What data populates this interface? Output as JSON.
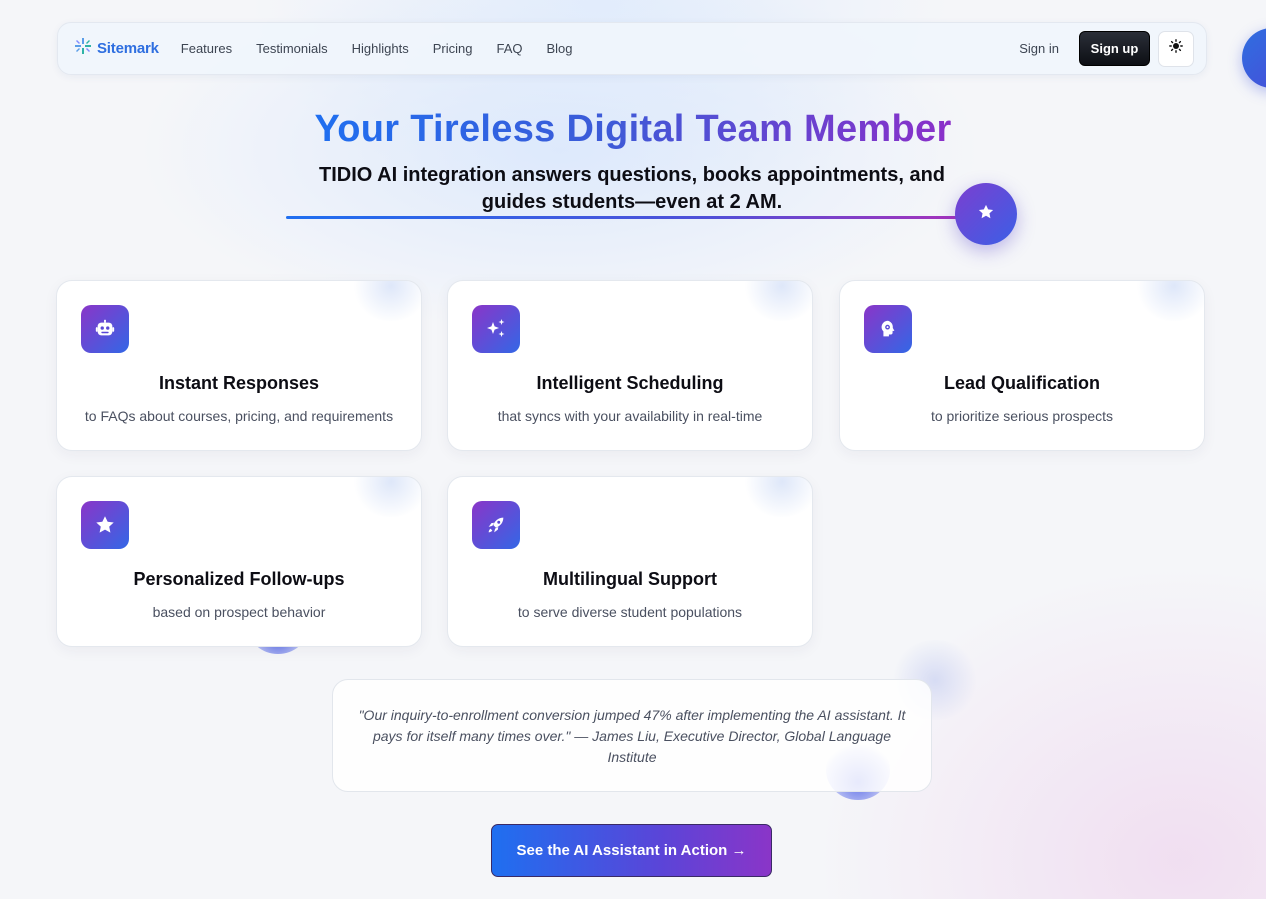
{
  "nav": {
    "logo_text": "Sitemark",
    "links": [
      "Features",
      "Testimonials",
      "Highlights",
      "Pricing",
      "FAQ",
      "Blog"
    ],
    "signin_label": "Sign in",
    "signup_label": "Sign up"
  },
  "hero": {
    "title": "Your Tireless Digital Team Member",
    "subtitle": "TIDIO AI integration answers questions, books appointments, and guides students—even at 2 AM."
  },
  "features": [
    {
      "icon": "robot-icon",
      "title": "Instant Responses",
      "desc": "to FAQs about courses, pricing, and requirements"
    },
    {
      "icon": "sparkles-icon",
      "title": "Intelligent Scheduling",
      "desc": "that syncs with your availability in real-time"
    },
    {
      "icon": "brain-gear-icon",
      "title": "Lead Qualification",
      "desc": "to prioritize serious prospects"
    },
    {
      "icon": "star-icon",
      "title": "Personalized Follow-ups",
      "desc": "based on prospect behavior"
    },
    {
      "icon": "rocket-icon",
      "title": "Multilingual Support",
      "desc": "to serve diverse student populations"
    }
  ],
  "testimonial": {
    "text": "\"Our inquiry-to-enrollment conversion jumped 47% after implementing the AI assistant. It pays for itself many times over.\" — James Liu, Executive Director, Global Language Institute"
  },
  "cta": {
    "label": "See the AI Assistant in Action →"
  },
  "colors": {
    "accent_blue": "#1f6ff0",
    "accent_purple": "#8a35c8",
    "logo_blue": "#2f6fe0",
    "signup_bg": "#0d0f14"
  }
}
